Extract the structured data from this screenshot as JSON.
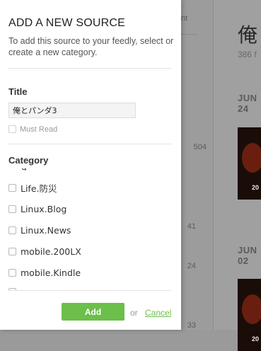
{
  "background": {
    "tab_fragment": "nt",
    "counts": [
      "504",
      "41",
      "24",
      "33"
    ],
    "feed_title": "俺",
    "feed_subtitle": "386 f",
    "dates": [
      "JUN 24",
      "JUN 02"
    ],
    "thumb_label": "20"
  },
  "modal": {
    "title": "ADD A NEW SOURCE",
    "description": "To add this source to your feedly, select or create a new category.",
    "title_label": "Title",
    "title_value": "俺とパンダ3",
    "must_read_label": "Must Read",
    "category_label": "Category",
    "categories": [
      {
        "label": "Life.防災",
        "checked": false
      },
      {
        "label": "Linux.Blog",
        "checked": false
      },
      {
        "label": "Linux.News",
        "checked": false
      },
      {
        "label": "mobile.200LX",
        "checked": false
      },
      {
        "label": "mobile.Kindle",
        "checked": false
      }
    ],
    "add_label": "Add",
    "or_text": "or",
    "cancel_label": "Cancel"
  },
  "colors": {
    "accent": "#6cbf4a",
    "overlay": "#9a9a9a"
  }
}
